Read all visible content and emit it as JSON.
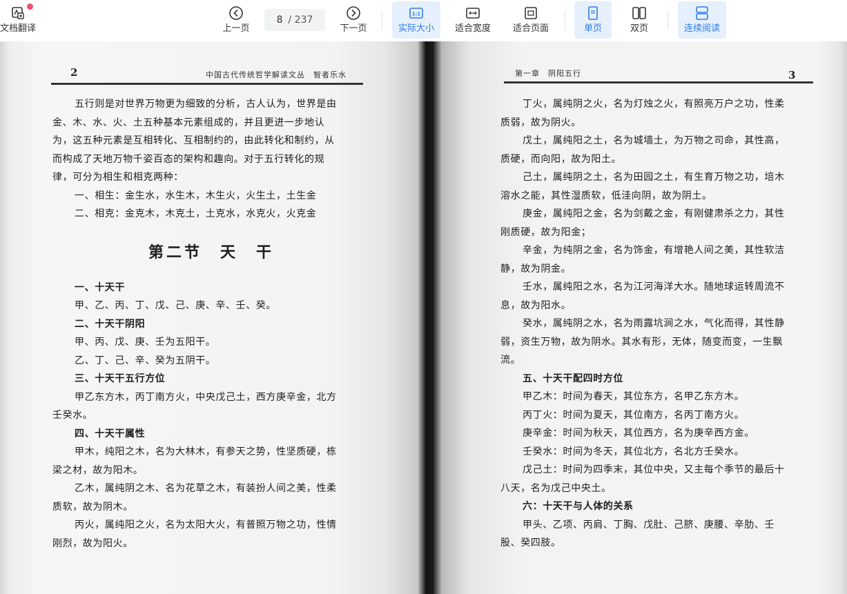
{
  "toolbar": {
    "translate_label": "文档翻译",
    "prev_label": "上一页",
    "next_label": "下一页",
    "current_page": "8",
    "total_pages": "/ 237",
    "actual_size_label": "实际大小",
    "fit_width_label": "适合宽度",
    "fit_page_label": "适合页面",
    "single_page_label": "单页",
    "double_page_label": "双页",
    "continuous_label": "连续阅读"
  },
  "left_page": {
    "number": "2",
    "header": "中国古代传统哲学解读文丛　智者乐水",
    "lines": [
      "五行则是对世界万物更为细致的分析，古人认为，世界是由",
      "金、木、水、火、土五种基本元素组成的，并且更进一步地认",
      "为，这五种元素是互相转化、互相制约的，由此转化和制约，从",
      "而构成了天地万物千姿百态的架构和趣向。对于五行转化的规",
      "律，可分为相生和相克两种：",
      "一、相生：金生水，水生木，木生火，火生土，土生金",
      "二、相克：金克木，木克土，土克水，水克火，火克金",
      "第二节　天　干",
      "一、十天干",
      "甲、乙、丙、丁、戊、己、庚、辛、壬、癸。",
      "二、十天干阴阳",
      "甲、丙、戊、庚、壬为五阳干。",
      "乙、丁、己、辛、癸为五阴干。",
      "三、十天干五行方位",
      "甲乙东方木，丙丁南方火，中央戊己土，西方庚辛金，北方",
      "壬癸水。",
      "四、十天干属性",
      "甲木，纯阳之木，名为大林木，有参天之势，性坚质硬，栋",
      "梁之材，故为阳木。",
      "乙木，属纯阴之木、名为花草之木，有装扮人间之美，性柔",
      "质软，故为阴木。",
      "丙火，属纯阳之火，名为太阳大火，有普照万物之功，性情",
      "刚烈，故为阳火。"
    ]
  },
  "right_page": {
    "number": "3",
    "header": "第一章　阴阳五行",
    "lines": [
      "丁火，属纯阴之火，名为灯烛之火，有照亮万户之功，性柔",
      "质弱，故为阴火。",
      "戊土，属纯阳之土，名为城墙土，为万物之司命，其性高，",
      "质硬，而向阳，故为阳土。",
      "己土，属纯阴之土，名为田园之土，有生育万物之功，培木",
      "溶水之能，其性湿质软，低洼向阴，故为阴土。",
      "庚金，属纯阳之金，名为剑戴之金，有刚健肃杀之力，其性",
      "刚质硬，故为阳金；",
      "辛金，为纯阴之金，名为饰金，有增艳人间之美，其性软洁",
      "静，故为阴金。",
      "壬水，属纯阳之水，名为江河海洋大水。随地球运转周流不",
      "息，故为阳水。",
      "癸水，属纯阴之水，名为雨露坑涧之水，气化而得，其性静",
      "弱，资生万物，故为阴水。其水有形，无体，随变而变，一生飘",
      "流。",
      "五、十天干配四时方位",
      "甲乙木：时间为春天，其位东方，名甲乙东方木。",
      "丙丁火：时间为夏天，其位南方，名丙丁南方火。",
      "庚辛金：时间为秋天，其位西方，名为庚辛西方金。",
      "壬癸水：时间为冬天，其位北方，名北方壬癸水。",
      "戊己土：时间为四季末，其位中央，又主每个季节的最后十",
      "八天，名为戊己中央土。",
      "六：十天干与人体的关系",
      "甲头、乙项、丙肩、丁胸、戊肚、己脐、庚腰、辛肋、壬",
      "股、癸四肢。"
    ]
  }
}
